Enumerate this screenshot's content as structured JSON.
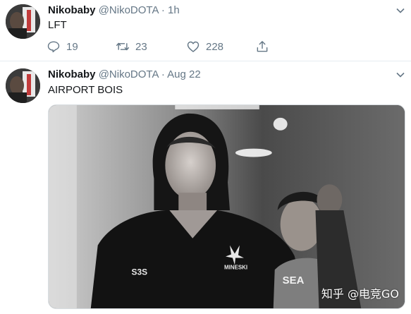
{
  "tweets": [
    {
      "display_name": "Nikobaby",
      "handle": "@NikoDOTA",
      "separator": "·",
      "time": "1h",
      "text": "LFT",
      "actions": {
        "replies": "19",
        "retweets": "23",
        "likes": "228"
      }
    },
    {
      "display_name": "Nikobaby",
      "handle": "@NikoDOTA",
      "separator": "·",
      "time": "Aug 22",
      "text": "AIRPORT BOIS",
      "media": {
        "jacket_brand": "MINESKI",
        "sponsor": "SEA",
        "sleeve": "S3S"
      }
    }
  ],
  "watermark": "知乎 @电竞GO",
  "colors": {
    "text": "#14171a",
    "secondary": "#657786",
    "border": "#e6ecf0"
  }
}
